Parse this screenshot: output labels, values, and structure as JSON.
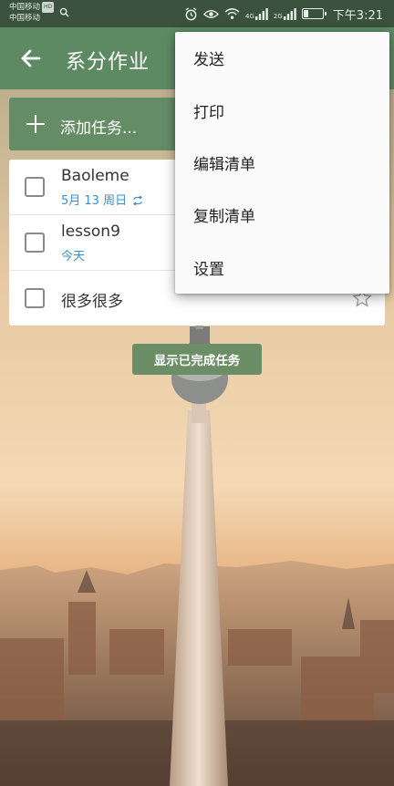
{
  "status_bar": {
    "carrier_1": "中国移动",
    "carrier_1_badge": "HD",
    "carrier_2": "中国移动",
    "network_1": "4G",
    "network_2": "2G",
    "time": "下午3:21",
    "icons": [
      "search-icon",
      "alarm-icon",
      "eye-icon",
      "wifi-icon",
      "signal-icon",
      "battery-icon"
    ]
  },
  "toolbar": {
    "back_icon": "arrow-left-icon",
    "title": "系分作业"
  },
  "add_task": {
    "icon": "plus-icon",
    "label": "添加任务..."
  },
  "tasks": [
    {
      "title": "Baoleme",
      "meta": "5月 13 周日",
      "meta_icon": "repeat-icon",
      "starred": false
    },
    {
      "title": "lesson9",
      "meta": "今天",
      "starred": false
    },
    {
      "title": "很多很多",
      "meta": "",
      "starred": false
    }
  ],
  "show_completed": "显示已完成任务",
  "menu": {
    "items": [
      "发送",
      "打印",
      "编辑清单",
      "复制清单",
      "设置"
    ]
  },
  "colors": {
    "status_bar": "#39513d",
    "toolbar": "#5d8a63",
    "accent_blue": "#3b8fc9",
    "menu_bg": "#fafafa"
  }
}
